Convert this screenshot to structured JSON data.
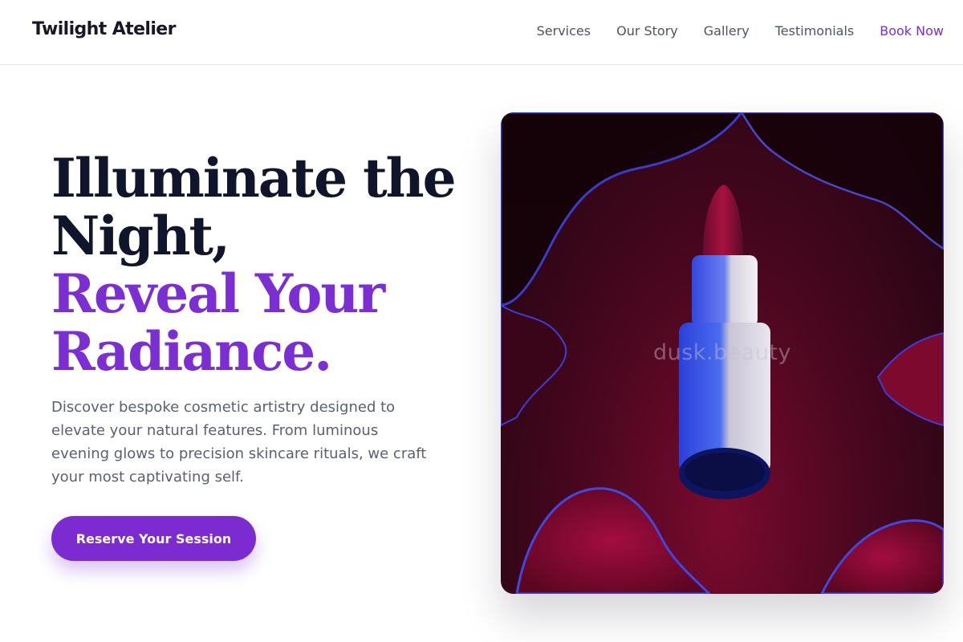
{
  "header": {
    "brand": "Twilight Atelier",
    "nav": [
      {
        "label": "Services"
      },
      {
        "label": "Our Story"
      },
      {
        "label": "Gallery"
      },
      {
        "label": "Testimonials"
      },
      {
        "label": "Book Now"
      }
    ]
  },
  "hero": {
    "headline_lines": [
      "Illuminate the",
      "Night,",
      "Reveal Your",
      "Radiance."
    ],
    "description": "Discover bespoke cosmetic artistry designed to elevate your natural features. From luminous evening glows to precision skincare rituals, we craft your most captivating self.",
    "cta_label": "Reserve Your Session",
    "image_watermark": "dusk.beauty"
  },
  "colors": {
    "accent": "#7b2fd2",
    "headline": "#10152b",
    "button": "#7b2bd0"
  }
}
